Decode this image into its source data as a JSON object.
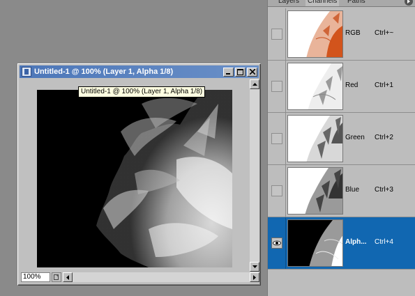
{
  "document": {
    "title": "Untitled-1 @ 100% (Layer 1, Alpha 1/8)",
    "tooltip": "Untitled-1 @ 100% (Layer 1, Alpha 1/8)",
    "zoom": "100%",
    "canvas_content": "white-flower-petals-alpha"
  },
  "panel": {
    "tabs": [
      {
        "label": "Layers",
        "active": false
      },
      {
        "label": "Channels",
        "active": true
      },
      {
        "label": "Paths",
        "active": false
      }
    ],
    "channels": [
      {
        "name": "RGB",
        "shortcut": "Ctrl+~",
        "visible": false,
        "selected": false,
        "tint": "#c8501e"
      },
      {
        "name": "Red",
        "shortcut": "Ctrl+1",
        "visible": false,
        "selected": false,
        "tint": "#9a9a9a"
      },
      {
        "name": "Green",
        "shortcut": "Ctrl+2",
        "visible": false,
        "selected": false,
        "tint": "#666666"
      },
      {
        "name": "Blue",
        "shortcut": "Ctrl+3",
        "visible": false,
        "selected": false,
        "tint": "#333333"
      },
      {
        "name": "Alpha 1",
        "display_name": "Alph...",
        "shortcut": "Ctrl+4",
        "visible": true,
        "selected": true,
        "tint": "#000000"
      }
    ]
  },
  "colors": {
    "workspace": "#8a8a8a",
    "titlebar": "#4c76b8",
    "selection": "#1167b1",
    "panel": "#bdbdbd"
  }
}
